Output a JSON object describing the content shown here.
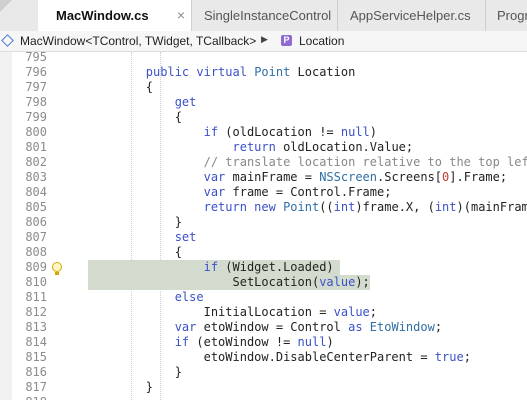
{
  "tabs": [
    {
      "label": "MacWindow.cs",
      "active": true,
      "close": "×"
    },
    {
      "label": "SingleInstanceControl",
      "active": false
    },
    {
      "label": "AppServiceHelper.cs",
      "active": false
    },
    {
      "label": "Progr",
      "active": false
    }
  ],
  "breadcrumb": {
    "type_name": "MacWindow<TControl, TWidget, TCallback>",
    "separator": "▶",
    "member_icon_letter": "P",
    "member_name": "Location"
  },
  "editor": {
    "highlight_color": "#d3dbcf",
    "lines": [
      {
        "num": "795",
        "code": ""
      },
      {
        "num": "796",
        "code": "        <span class='kw'>public virtual</span> <span class='ty'>Point</span> Location"
      },
      {
        "num": "797",
        "code": "        {"
      },
      {
        "num": "798",
        "code": "            <span class='kw'>get</span>"
      },
      {
        "num": "799",
        "code": "            {"
      },
      {
        "num": "800",
        "code": "                <span class='kw'>if</span> (oldLocation != <span class='kw'>null</span>)"
      },
      {
        "num": "801",
        "code": "                    <span class='kw'>return</span> oldLocation.Value;"
      },
      {
        "num": "802",
        "code": "                <span class='cm'>// translate location relative to the top left</span>"
      },
      {
        "num": "803",
        "code": "                <span class='kw'>var</span> mainFrame = <span class='ty'>NSScreen</span>.Screens[<span class='nm'>0</span>].Frame;"
      },
      {
        "num": "804",
        "code": "                <span class='kw'>var</span> frame = Control.Frame;"
      },
      {
        "num": "805",
        "code": "                <span class='kw'>return new</span> <span class='ty'>Point</span>((<span class='kw'>int</span>)frame.X, (<span class='kw'>int</span>)(mainFrame"
      },
      {
        "num": "806",
        "code": "            }"
      },
      {
        "num": "807",
        "code": "            <span class='kw'>set</span>"
      },
      {
        "num": "808",
        "code": "            {"
      },
      {
        "num": "809",
        "code": "                <span class='kw'>if</span> (Widget.Loaded)",
        "highlight": true,
        "bulb": true
      },
      {
        "num": "810",
        "code": "                    SetLocation(<span class='kw'>value</span>);",
        "highlight": true
      },
      {
        "num": "811",
        "code": "            <span class='kw'>else</span>"
      },
      {
        "num": "812",
        "code": "                InitialLocation = <span class='kw'>value</span>;"
      },
      {
        "num": "813",
        "code": "            <span class='kw'>var</span> etoWindow = Control <span class='kw'>as</span> <span class='ty'>EtoWindow</span>;"
      },
      {
        "num": "814",
        "code": "            <span class='kw'>if</span> (etoWindow != <span class='kw'>null</span>)"
      },
      {
        "num": "815",
        "code": "                etoWindow.DisableCenterParent = <span class='kw'>true</span>;"
      },
      {
        "num": "816",
        "code": "            }"
      },
      {
        "num": "817",
        "code": "        }"
      },
      {
        "num": "818",
        "code": ""
      }
    ]
  }
}
